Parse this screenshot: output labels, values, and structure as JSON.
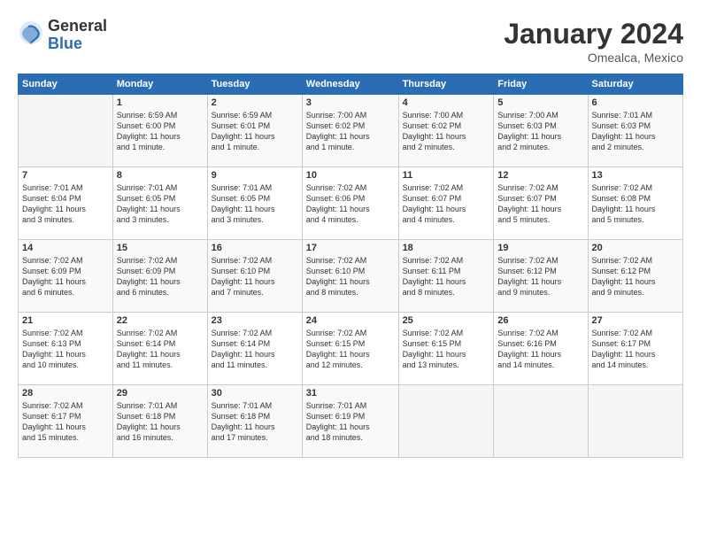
{
  "logo": {
    "general": "General",
    "blue": "Blue"
  },
  "title": "January 2024",
  "subtitle": "Omealca, Mexico",
  "days_header": [
    "Sunday",
    "Monday",
    "Tuesday",
    "Wednesday",
    "Thursday",
    "Friday",
    "Saturday"
  ],
  "weeks": [
    [
      {
        "day": "",
        "info": ""
      },
      {
        "day": "1",
        "info": "Sunrise: 6:59 AM\nSunset: 6:00 PM\nDaylight: 11 hours\nand 1 minute."
      },
      {
        "day": "2",
        "info": "Sunrise: 6:59 AM\nSunset: 6:01 PM\nDaylight: 11 hours\nand 1 minute."
      },
      {
        "day": "3",
        "info": "Sunrise: 7:00 AM\nSunset: 6:02 PM\nDaylight: 11 hours\nand 1 minute."
      },
      {
        "day": "4",
        "info": "Sunrise: 7:00 AM\nSunset: 6:02 PM\nDaylight: 11 hours\nand 2 minutes."
      },
      {
        "day": "5",
        "info": "Sunrise: 7:00 AM\nSunset: 6:03 PM\nDaylight: 11 hours\nand 2 minutes."
      },
      {
        "day": "6",
        "info": "Sunrise: 7:01 AM\nSunset: 6:03 PM\nDaylight: 11 hours\nand 2 minutes."
      }
    ],
    [
      {
        "day": "7",
        "info": "Sunrise: 7:01 AM\nSunset: 6:04 PM\nDaylight: 11 hours\nand 3 minutes."
      },
      {
        "day": "8",
        "info": "Sunrise: 7:01 AM\nSunset: 6:05 PM\nDaylight: 11 hours\nand 3 minutes."
      },
      {
        "day": "9",
        "info": "Sunrise: 7:01 AM\nSunset: 6:05 PM\nDaylight: 11 hours\nand 3 minutes."
      },
      {
        "day": "10",
        "info": "Sunrise: 7:02 AM\nSunset: 6:06 PM\nDaylight: 11 hours\nand 4 minutes."
      },
      {
        "day": "11",
        "info": "Sunrise: 7:02 AM\nSunset: 6:07 PM\nDaylight: 11 hours\nand 4 minutes."
      },
      {
        "day": "12",
        "info": "Sunrise: 7:02 AM\nSunset: 6:07 PM\nDaylight: 11 hours\nand 5 minutes."
      },
      {
        "day": "13",
        "info": "Sunrise: 7:02 AM\nSunset: 6:08 PM\nDaylight: 11 hours\nand 5 minutes."
      }
    ],
    [
      {
        "day": "14",
        "info": "Sunrise: 7:02 AM\nSunset: 6:09 PM\nDaylight: 11 hours\nand 6 minutes."
      },
      {
        "day": "15",
        "info": "Sunrise: 7:02 AM\nSunset: 6:09 PM\nDaylight: 11 hours\nand 6 minutes."
      },
      {
        "day": "16",
        "info": "Sunrise: 7:02 AM\nSunset: 6:10 PM\nDaylight: 11 hours\nand 7 minutes."
      },
      {
        "day": "17",
        "info": "Sunrise: 7:02 AM\nSunset: 6:10 PM\nDaylight: 11 hours\nand 8 minutes."
      },
      {
        "day": "18",
        "info": "Sunrise: 7:02 AM\nSunset: 6:11 PM\nDaylight: 11 hours\nand 8 minutes."
      },
      {
        "day": "19",
        "info": "Sunrise: 7:02 AM\nSunset: 6:12 PM\nDaylight: 11 hours\nand 9 minutes."
      },
      {
        "day": "20",
        "info": "Sunrise: 7:02 AM\nSunset: 6:12 PM\nDaylight: 11 hours\nand 9 minutes."
      }
    ],
    [
      {
        "day": "21",
        "info": "Sunrise: 7:02 AM\nSunset: 6:13 PM\nDaylight: 11 hours\nand 10 minutes."
      },
      {
        "day": "22",
        "info": "Sunrise: 7:02 AM\nSunset: 6:14 PM\nDaylight: 11 hours\nand 11 minutes."
      },
      {
        "day": "23",
        "info": "Sunrise: 7:02 AM\nSunset: 6:14 PM\nDaylight: 11 hours\nand 11 minutes."
      },
      {
        "day": "24",
        "info": "Sunrise: 7:02 AM\nSunset: 6:15 PM\nDaylight: 11 hours\nand 12 minutes."
      },
      {
        "day": "25",
        "info": "Sunrise: 7:02 AM\nSunset: 6:15 PM\nDaylight: 11 hours\nand 13 minutes."
      },
      {
        "day": "26",
        "info": "Sunrise: 7:02 AM\nSunset: 6:16 PM\nDaylight: 11 hours\nand 14 minutes."
      },
      {
        "day": "27",
        "info": "Sunrise: 7:02 AM\nSunset: 6:17 PM\nDaylight: 11 hours\nand 14 minutes."
      }
    ],
    [
      {
        "day": "28",
        "info": "Sunrise: 7:02 AM\nSunset: 6:17 PM\nDaylight: 11 hours\nand 15 minutes."
      },
      {
        "day": "29",
        "info": "Sunrise: 7:01 AM\nSunset: 6:18 PM\nDaylight: 11 hours\nand 16 minutes."
      },
      {
        "day": "30",
        "info": "Sunrise: 7:01 AM\nSunset: 6:18 PM\nDaylight: 11 hours\nand 17 minutes."
      },
      {
        "day": "31",
        "info": "Sunrise: 7:01 AM\nSunset: 6:19 PM\nDaylight: 11 hours\nand 18 minutes."
      },
      {
        "day": "",
        "info": ""
      },
      {
        "day": "",
        "info": ""
      },
      {
        "day": "",
        "info": ""
      }
    ]
  ]
}
